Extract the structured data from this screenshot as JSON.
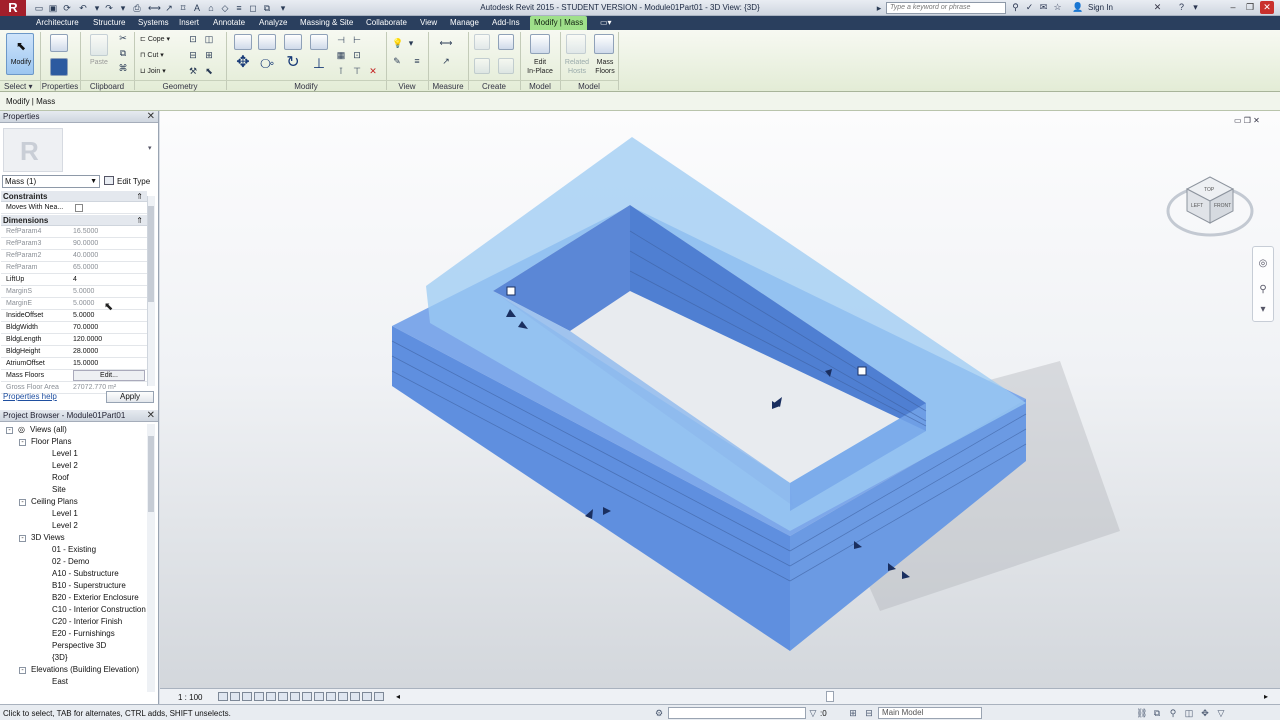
{
  "window": {
    "title": "Autodesk Revit 2015 - STUDENT VERSION -   Module01Part01 - 3D View: {3D}",
    "logo": "R",
    "search_placeholder": "Type a keyword or phrase",
    "sign_in": "Sign In"
  },
  "tabs": [
    "Architecture",
    "Structure",
    "Systems",
    "Insert",
    "Annotate",
    "Analyze",
    "Massing & Site",
    "Collaborate",
    "View",
    "Manage",
    "Add-Ins",
    "Modify | Mass"
  ],
  "ribbon": {
    "modify_label": "Modify",
    "select_label": "Select",
    "panels": {
      "properties": "Properties",
      "clipboard": "Clipboard",
      "geometry": "Geometry",
      "modify": "Modify",
      "view": "View",
      "measure": "Measure",
      "create": "Create",
      "model1": "Model",
      "model2": "Model"
    },
    "paste_label": "Paste",
    "cope_label": "Cope",
    "cut_label": "Cut",
    "join_label": "Join",
    "edit_inplace_label": "Edit\nIn-Place",
    "related_hosts_label": "Related\nHosts",
    "mass_floors_label": "Mass\nFloors"
  },
  "context_label": "Modify | Mass",
  "properties": {
    "header": "Properties",
    "type_selector": "Mass (1)",
    "edit_type": "Edit Type",
    "groups": {
      "constraints": "Constraints",
      "dimensions": "Dimensions"
    },
    "constraint_rows": [
      {
        "name": "Moves With Nea...",
        "value": ""
      }
    ],
    "dimension_rows": [
      {
        "name": "RefParam4",
        "value": "16.5000",
        "dim": true
      },
      {
        "name": "RefParam3",
        "value": "90.0000",
        "dim": true
      },
      {
        "name": "RefParam2",
        "value": "40.0000",
        "dim": true
      },
      {
        "name": "RefParam",
        "value": "65.0000",
        "dim": true
      },
      {
        "name": "LiftUp",
        "value": "4",
        "dim": false
      },
      {
        "name": "MarginS",
        "value": "5.0000",
        "dim": true
      },
      {
        "name": "MarginE",
        "value": "5.0000",
        "dim": true
      },
      {
        "name": "InsideOffset",
        "value": "5.0000",
        "dim": false
      },
      {
        "name": "BldgWidth",
        "value": "70.0000",
        "dim": false
      },
      {
        "name": "BldgLength",
        "value": "120.0000",
        "dim": false
      },
      {
        "name": "BldgHeight",
        "value": "28.0000",
        "dim": false
      },
      {
        "name": "AtriumOffset",
        "value": "15.0000",
        "dim": false
      },
      {
        "name": "Mass Floors",
        "value": "Edit...",
        "dim": false
      },
      {
        "name": "Gross Floor Area",
        "value": "27072.770 m²",
        "dim": true
      }
    ],
    "help": "Properties help",
    "apply": "Apply"
  },
  "project_browser": {
    "header": "Project Browser - Module01Part01",
    "items": [
      {
        "label": "Views (all)",
        "level": 0,
        "toggle": "-"
      },
      {
        "label": "Floor Plans",
        "level": 1,
        "toggle": "-"
      },
      {
        "label": "Level 1",
        "level": 2,
        "toggle": ""
      },
      {
        "label": "Level 2",
        "level": 2,
        "toggle": ""
      },
      {
        "label": "Roof",
        "level": 2,
        "toggle": ""
      },
      {
        "label": "Site",
        "level": 2,
        "toggle": ""
      },
      {
        "label": "Ceiling Plans",
        "level": 1,
        "toggle": "-"
      },
      {
        "label": "Level 1",
        "level": 2,
        "toggle": ""
      },
      {
        "label": "Level 2",
        "level": 2,
        "toggle": ""
      },
      {
        "label": "3D Views",
        "level": 1,
        "toggle": "-"
      },
      {
        "label": "01 - Existing",
        "level": 2,
        "toggle": ""
      },
      {
        "label": "02 - Demo",
        "level": 2,
        "toggle": ""
      },
      {
        "label": "A10 - Substructure",
        "level": 2,
        "toggle": ""
      },
      {
        "label": "B10 - Superstructure",
        "level": 2,
        "toggle": ""
      },
      {
        "label": "B20 - Exterior Enclosure",
        "level": 2,
        "toggle": ""
      },
      {
        "label": "C10 - Interior Construction",
        "level": 2,
        "toggle": ""
      },
      {
        "label": "C20 - Interior Finish",
        "level": 2,
        "toggle": ""
      },
      {
        "label": "E20 - Furnishings",
        "level": 2,
        "toggle": ""
      },
      {
        "label": "Perspective 3D",
        "level": 2,
        "toggle": ""
      },
      {
        "label": "{3D}",
        "level": 2,
        "toggle": ""
      },
      {
        "label": "Elevations (Building Elevation)",
        "level": 1,
        "toggle": "-"
      },
      {
        "label": "East",
        "level": 2,
        "toggle": ""
      }
    ]
  },
  "viewcube": {
    "top": "TOP",
    "left": "LEFT",
    "front": "FRONT"
  },
  "view_controls": {
    "scale": "1 : 100"
  },
  "status": {
    "text": "Click to select, TAB for alternates, CTRL adds, SHIFT unselects.",
    "filter_count": ":0",
    "main_model": "Main Model"
  },
  "colors": {
    "accent_tab": "#9fe08a",
    "mass_fill": "#6f9fe6",
    "tabbar": "#2a3f5e"
  }
}
